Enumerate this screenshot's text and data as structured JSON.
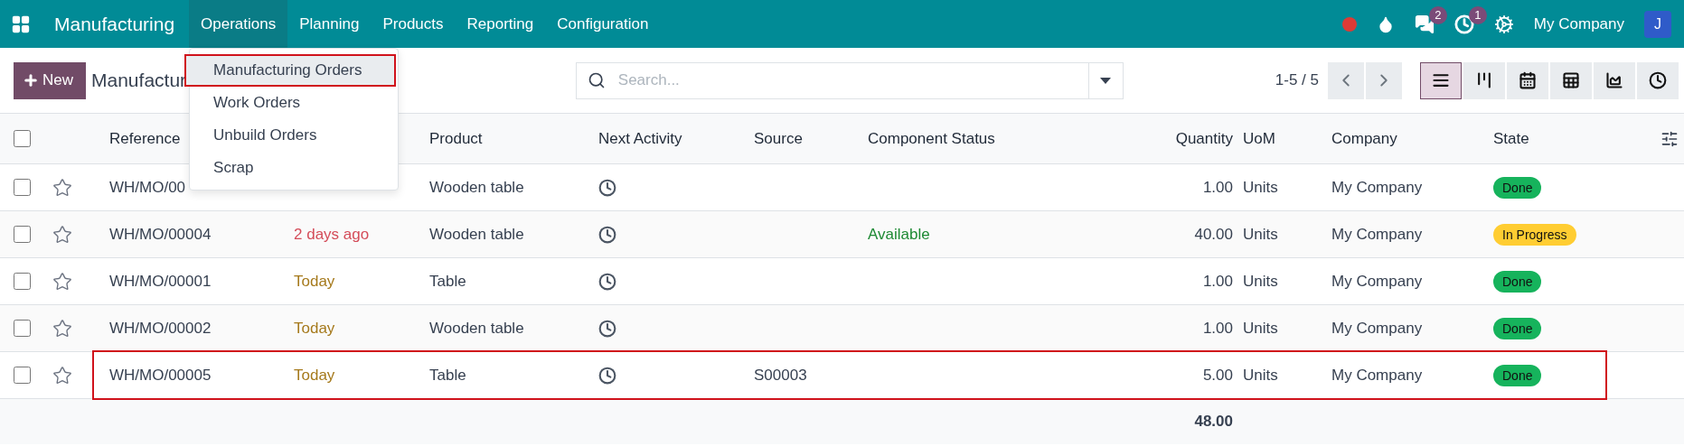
{
  "navbar": {
    "app": "Manufacturing",
    "menus": [
      {
        "label": "Operations",
        "selected": true
      },
      {
        "label": "Planning",
        "selected": false
      },
      {
        "label": "Products",
        "selected": false
      },
      {
        "label": "Reporting",
        "selected": false
      },
      {
        "label": "Configuration",
        "selected": false
      }
    ],
    "dropdown": [
      {
        "label": "Manufacturing Orders",
        "highlighted": true
      },
      {
        "label": "Work Orders",
        "highlighted": false
      },
      {
        "label": "Unbuild Orders",
        "highlighted": false
      },
      {
        "label": "Scrap",
        "highlighted": false
      }
    ],
    "systray": {
      "chat_count": "2",
      "activity_count": "1",
      "company": "My Company",
      "avatar": "J"
    }
  },
  "control_panel": {
    "new_button": "New",
    "title": "Manufactur",
    "search": {
      "placeholder": "Search..."
    },
    "pager": "1-5 / 5",
    "views": [
      {
        "kind": "list",
        "selected": true
      },
      {
        "kind": "kanban",
        "selected": false
      },
      {
        "kind": "calendar",
        "selected": false
      },
      {
        "kind": "pivot",
        "selected": false
      },
      {
        "kind": "graph",
        "selected": false
      },
      {
        "kind": "activity",
        "selected": false
      }
    ]
  },
  "table": {
    "select_all_checked": false,
    "columns": [
      "Reference",
      "Product",
      "Next Activity",
      "Source",
      "Component Status",
      "Quantity",
      "UoM",
      "Company",
      "State"
    ],
    "rows": [
      {
        "checked": false,
        "reference": "WH/MO/00",
        "product": "Wooden table",
        "quantity": "1.00",
        "uom": "Units",
        "company": "My Company",
        "state": {
          "text": "Done",
          "color": "#16b35c"
        },
        "highlighted": false
      },
      {
        "checked": false,
        "reference": "WH/MO/00004",
        "date": {
          "text": "2 days ago",
          "color": "#d44c59"
        },
        "product": "Wooden table",
        "component_status": "Available",
        "quantity": "40.00",
        "uom": "Units",
        "company": "My Company",
        "state": {
          "text": "In Progress",
          "color": "#ffcd32"
        },
        "highlighted": false
      },
      {
        "checked": false,
        "reference": "WH/MO/00001",
        "date": {
          "text": "Today",
          "color": "#a5791b"
        },
        "product": "Table",
        "quantity": "1.00",
        "uom": "Units",
        "company": "My Company",
        "state": {
          "text": "Done",
          "color": "#16b35c"
        },
        "highlighted": false
      },
      {
        "checked": false,
        "reference": "WH/MO/00002",
        "date": {
          "text": "Today",
          "color": "#a5791b"
        },
        "product": "Wooden table",
        "quantity": "1.00",
        "uom": "Units",
        "company": "My Company",
        "state": {
          "text": "Done",
          "color": "#16b35c"
        },
        "highlighted": false
      },
      {
        "checked": false,
        "reference": "WH/MO/00005",
        "date": {
          "text": "Today",
          "color": "#a5791b"
        },
        "product": "Table",
        "source": "S00003",
        "quantity": "5.00",
        "uom": "Units",
        "company": "My Company",
        "state": {
          "text": "Done",
          "color": "#16b35c"
        },
        "highlighted": true
      }
    ],
    "total_quantity": "48.00"
  }
}
